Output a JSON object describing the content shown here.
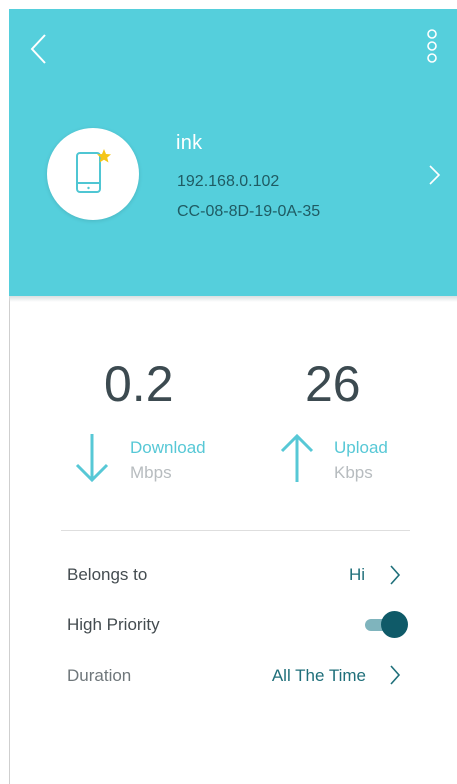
{
  "device": {
    "name": "ink",
    "ip": "192.168.0.102",
    "mac": "CC-08-8D-19-0A-35",
    "icon": "phone-star-icon"
  },
  "speeds": {
    "download": {
      "value": "0.2",
      "label": "Download",
      "unit": "Mbps"
    },
    "upload": {
      "value": "26",
      "label": "Upload",
      "unit": "Kbps"
    }
  },
  "settings": {
    "belongs_to": {
      "label": "Belongs to",
      "value": "Hi"
    },
    "high_priority": {
      "label": "High Priority",
      "enabled": true
    },
    "duration": {
      "label": "Duration",
      "value": "All The Time"
    }
  },
  "colors": {
    "header": "#55cfdc",
    "accent": "#57c8d6",
    "toggle_on": "#0f5a68",
    "value_text": "#1f6f7a"
  }
}
